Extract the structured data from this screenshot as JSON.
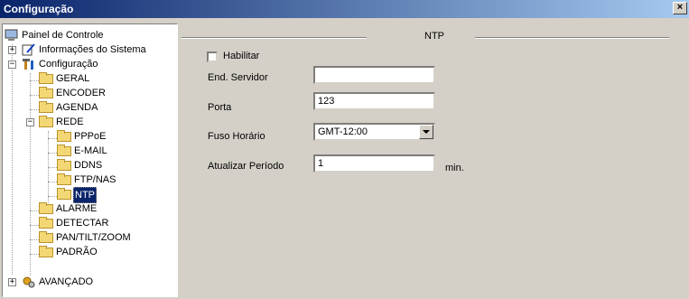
{
  "window": {
    "title": "Configuração",
    "close_label": "×"
  },
  "tree": {
    "painel": "Painel de Controle",
    "info": "Informações do Sistema",
    "config": "Configuração",
    "geral": "GERAL",
    "encoder": "ENCODER",
    "agenda": "AGENDA",
    "rede": "REDE",
    "pppoe": "PPPoE",
    "email": "E-MAIL",
    "ddns": "DDNS",
    "ftpnas": "FTP/NAS",
    "ntp": "NTP",
    "alarme": "ALARME",
    "detectar": "DETECTAR",
    "ptz": "PAN/TILT/ZOOM",
    "padrao": "PADRÃO",
    "avancado": "AVANÇADO",
    "expand_plus": "+",
    "expand_minus": "−"
  },
  "ntp": {
    "legend": "NTP",
    "habilitar_label": "Habilitar",
    "habilitar_checked": false,
    "servidor_label": "End. Servidor",
    "servidor_value": "",
    "porta_label": "Porta",
    "porta_value": "123",
    "fuso_label": "Fuso Horário",
    "fuso_value": "GMT-12:00",
    "periodo_label": "Atualizar Período",
    "periodo_value": "1",
    "periodo_unit": "min."
  }
}
